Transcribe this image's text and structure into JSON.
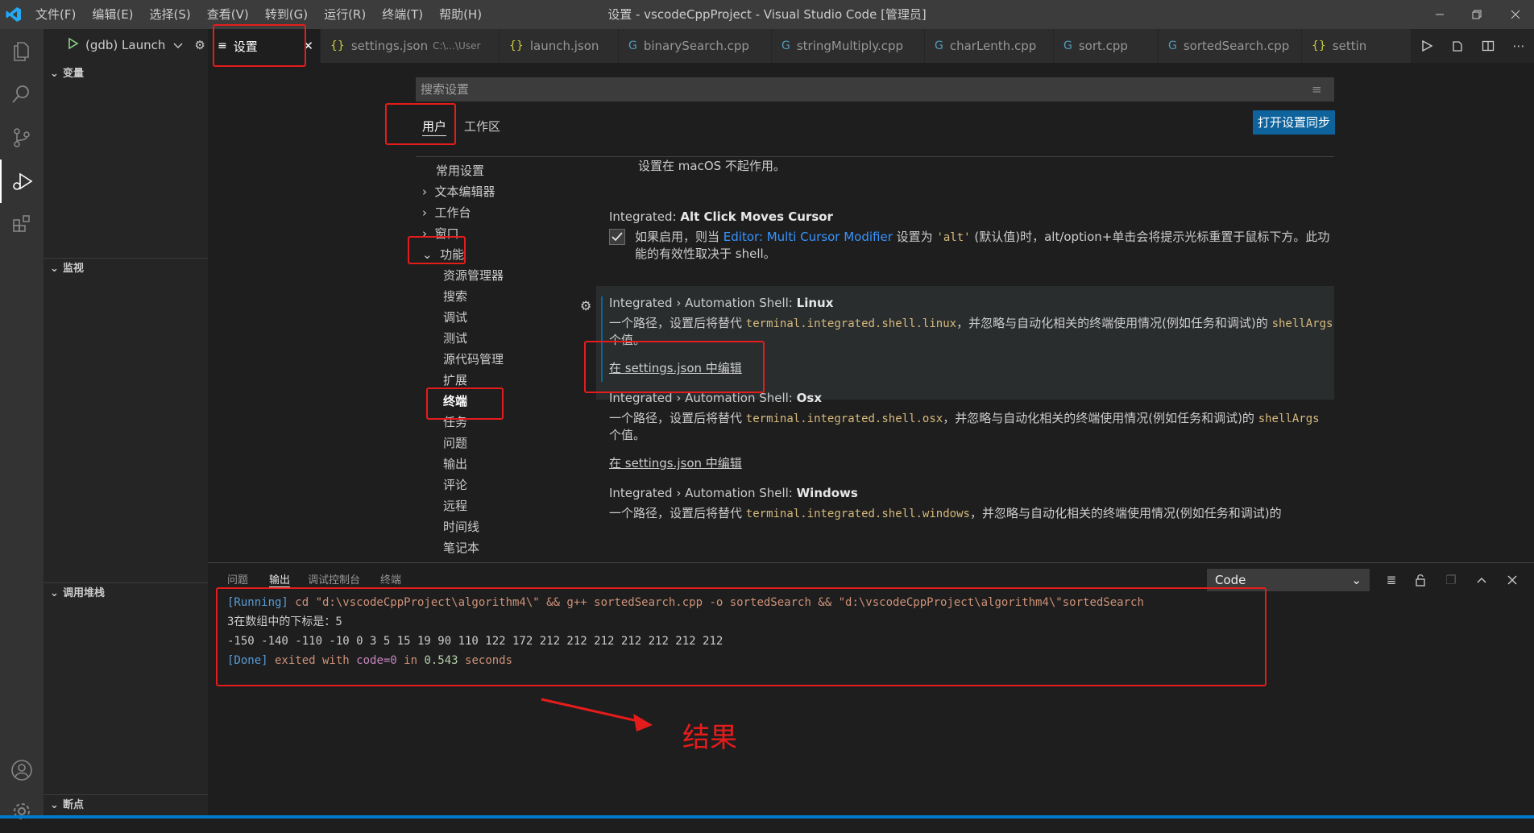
{
  "titlebar": {
    "window_title": "设置 - vscodeCppProject - Visual Studio Code [管理员]",
    "menus": [
      "文件(F)",
      "编辑(E)",
      "选择(S)",
      "查看(V)",
      "转到(G)",
      "运行(R)",
      "终端(T)",
      "帮助(H)"
    ]
  },
  "sidebar": {
    "debug_config": "(gdb) Launch",
    "sections": {
      "variables": "变量",
      "watch": "监视",
      "callstack": "调用堆栈",
      "breakpoints": "断点"
    }
  },
  "tabs": [
    {
      "label": "设置",
      "icon": "list-icon"
    },
    {
      "label": "settings.json",
      "sub": "C:\\...\\User",
      "icon": "braces-icon"
    },
    {
      "label": "launch.json",
      "icon": "braces-icon"
    },
    {
      "label": "binarySearch.cpp",
      "icon": "cpp-icon"
    },
    {
      "label": "stringMultiply.cpp",
      "icon": "cpp-icon"
    },
    {
      "label": "charLenth.cpp",
      "icon": "cpp-icon"
    },
    {
      "label": "sort.cpp",
      "icon": "cpp-icon"
    },
    {
      "label": "sortedSearch.cpp",
      "icon": "cpp-icon"
    },
    {
      "label": "settin",
      "icon": "braces-icon"
    }
  ],
  "settings": {
    "search_placeholder": "搜索设置",
    "scope_tabs": {
      "user": "用户",
      "workspace": "工作区"
    },
    "sync_button": "打开设置同步",
    "toc": {
      "common": "常用设置",
      "text_editor": "文本编辑器",
      "workbench": "工作台",
      "window": "窗口",
      "features": "功能",
      "features_children": [
        "资源管理器",
        "搜索",
        "调试",
        "测试",
        "源代码管理",
        "扩展",
        "终端",
        "任务",
        "问题",
        "输出",
        "评论",
        "远程",
        "时间线",
        "笔记本"
      ]
    },
    "top_text": "设置在 macOS 不起作用。",
    "alt_click": {
      "prefix": "Integrated: ",
      "name": "Alt Click Moves Cursor",
      "desc_a": "如果启用，则当 ",
      "link": "Editor: Multi Cursor Modifier",
      "desc_b": " 设置为 ",
      "code": "'alt'",
      "desc_c": " (默认值)时，alt/option+单击会将提示光标重置于鼠标下方。此功能的有效性取决于 shell。"
    },
    "linux": {
      "prefix": "Integrated › Automation Shell: ",
      "name": "Linux",
      "desc_a": "一个路径，设置后将替代 ",
      "code": "terminal.integrated.shell.linux",
      "desc_b": "，并忽略与自动化相关的终端使用情况(例如任务和调试)的 ",
      "code2": "shellArgs",
      "desc_c": " 个值。",
      "link": "在 settings.json 中编辑"
    },
    "osx": {
      "prefix": "Integrated › Automation Shell: ",
      "name": "Osx",
      "desc_a": "一个路径，设置后将替代 ",
      "code": "terminal.integrated.shell.osx",
      "desc_b": "，并忽略与自动化相关的终端使用情况(例如任务和调试)的 ",
      "code2": "shellArgs",
      "desc_c": " 个值。",
      "link": "在 settings.json 中编辑"
    },
    "windows": {
      "prefix": "Integrated › Automation Shell: ",
      "name": "Windows",
      "desc_a": "一个路径，设置后将替代 ",
      "code": "terminal.integrated.shell.windows",
      "desc_b": "，并忽略与自动化相关的终端使用情况(例如任务和调试)的"
    }
  },
  "panel": {
    "tabs": {
      "problems": "问题",
      "output": "输出",
      "debug_console": "调试控制台",
      "terminal": "终端"
    },
    "channel": "Code",
    "output": {
      "l1_tag": "[Running]",
      "l1_cmd": " cd \"d:\\vscodeCppProject\\algorithm4\\\" && g++ sortedSearch.cpp -o sortedSearch && \"d:\\vscodeCppProject\\algorithm4\\\"sortedSearch",
      "l2": "3在数组中的下标是：5",
      "l3": "-150 -140 -110 -10 0 3 5 15 19 90 110 122 172 212 212 212 212 212 212 212",
      "l4_tag": "[Done]",
      "l4_a": " exited with ",
      "l4_code": "code=0",
      "l4_b": " in ",
      "l4_num": "0.543",
      "l4_c": " seconds"
    }
  },
  "annotation": "结果",
  "colors": {
    "accent": "#007acc",
    "annotation_red": "#e51c1c",
    "button": "#0e639c"
  }
}
